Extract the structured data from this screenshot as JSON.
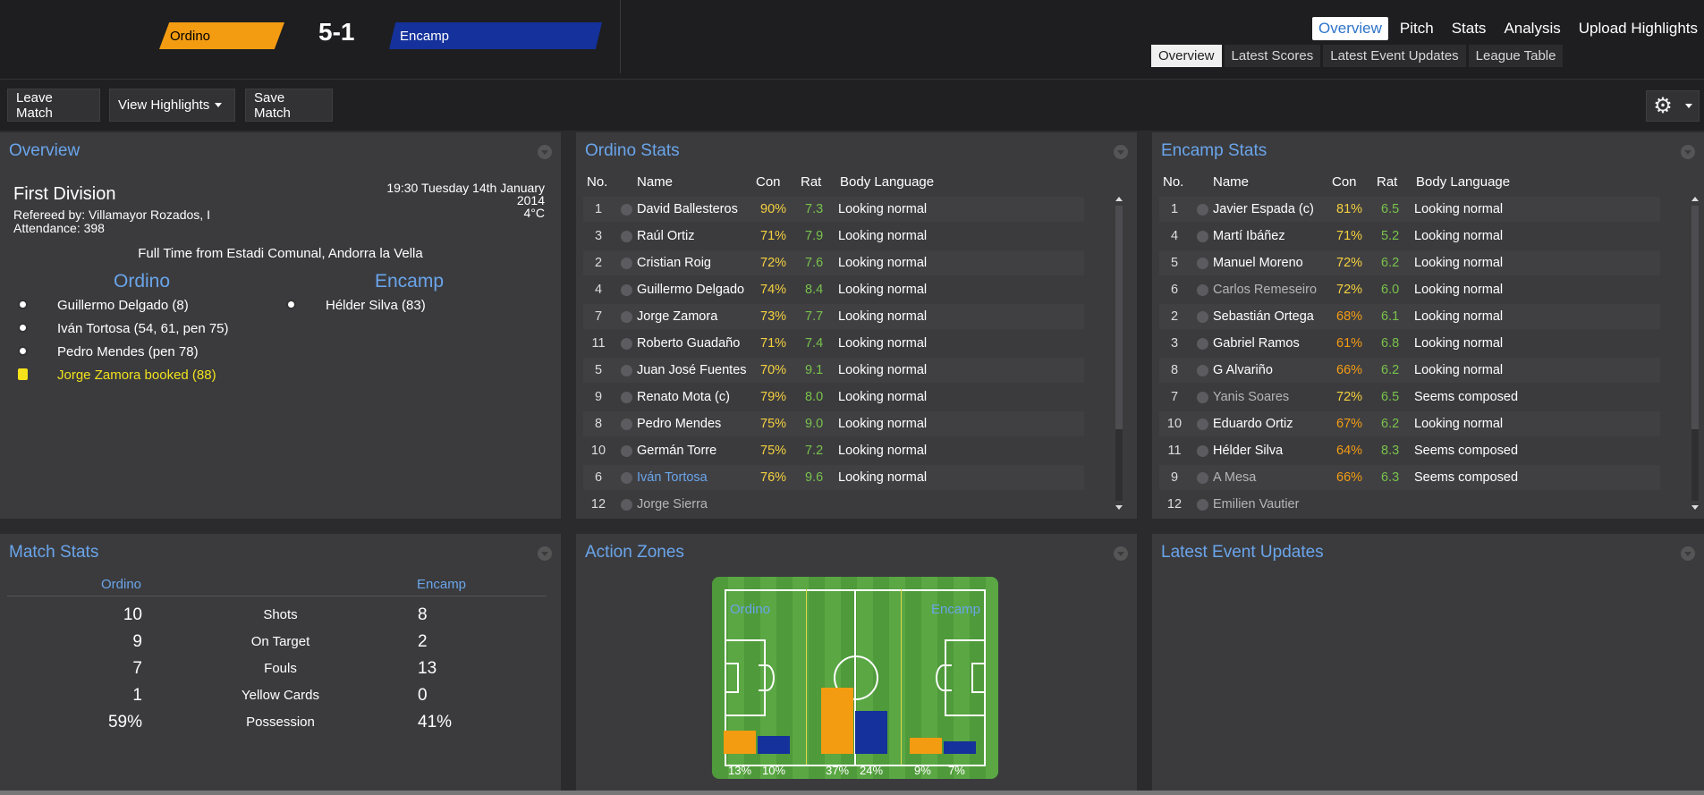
{
  "header": {
    "home_team": "Ordino",
    "away_team": "Encamp",
    "score": "5-1",
    "main_nav": [
      "Overview",
      "Pitch",
      "Stats",
      "Analysis",
      "Upload Highlights"
    ],
    "sub_nav": [
      "Overview",
      "Latest Scores",
      "Latest Event Updates",
      "League Table"
    ]
  },
  "toolbar": {
    "leave_label": "Leave Match",
    "highlights_label": "View Highlights",
    "save_label": "Save Match"
  },
  "overview": {
    "title": "Overview",
    "competition": "First Division",
    "referee": "Refereed by: Villamayor Rozados, I",
    "attendance": "Attendance: 398",
    "time": "19:30 Tuesday 14th January",
    "year": "2014",
    "temperature": "4°C",
    "status": "Full Time from Estadi Comunal, Andorra la Vella",
    "home_name": "Ordino",
    "away_name": "Encamp",
    "home_events": [
      {
        "text": "Guillermo Delgado (8)",
        "type": "goal"
      },
      {
        "text": "Iván Tortosa (54, 61, pen 75)",
        "type": "goal"
      },
      {
        "text": "Pedro Mendes (pen 78)",
        "type": "goal"
      },
      {
        "text": "Jorge Zamora booked (88)",
        "type": "yellow"
      }
    ],
    "away_events": [
      {
        "text": "Hélder Silva (83)",
        "type": "goal"
      }
    ]
  },
  "columns": {
    "no": "No.",
    "name": "Name",
    "con": "Con",
    "rat": "Rat",
    "body": "Body Language"
  },
  "home_stats": {
    "title": "Ordino Stats",
    "rows": [
      {
        "no": "1",
        "name": "David Ballesteros",
        "con": "90%",
        "rat": "7.3",
        "body": "Looking normal"
      },
      {
        "no": "3",
        "name": "Raúl Ortiz",
        "con": "71%",
        "rat": "7.9",
        "body": "Looking normal"
      },
      {
        "no": "2",
        "name": "Cristian Roig",
        "con": "72%",
        "rat": "7.6",
        "body": "Looking normal"
      },
      {
        "no": "4",
        "name": "Guillermo Delgado",
        "con": "74%",
        "rat": "8.4",
        "body": "Looking normal"
      },
      {
        "no": "7",
        "name": "Jorge Zamora",
        "con": "73%",
        "rat": "7.7",
        "body": "Looking normal"
      },
      {
        "no": "11",
        "name": "Roberto Guadaño",
        "con": "71%",
        "rat": "7.4",
        "body": "Looking normal"
      },
      {
        "no": "5",
        "name": "Juan José Fuentes",
        "con": "70%",
        "rat": "9.1",
        "body": "Looking normal"
      },
      {
        "no": "9",
        "name": "Renato Mota (c)",
        "con": "79%",
        "rat": "8.0",
        "body": "Looking normal"
      },
      {
        "no": "8",
        "name": "Pedro Mendes",
        "con": "75%",
        "rat": "9.0",
        "body": "Looking normal"
      },
      {
        "no": "10",
        "name": "Germán Torre",
        "con": "75%",
        "rat": "7.2",
        "body": "Looking normal"
      },
      {
        "no": "6",
        "name": "Iván Tortosa",
        "con": "76%",
        "rat": "9.6",
        "body": "Looking normal"
      },
      {
        "no": "12",
        "name": "Jorge Sierra",
        "con": "",
        "rat": "",
        "body": ""
      }
    ]
  },
  "away_stats": {
    "title": "Encamp Stats",
    "rows": [
      {
        "no": "1",
        "name": "Javier Espada (c)",
        "con": "81%",
        "rat": "6.5",
        "body": "Looking normal"
      },
      {
        "no": "4",
        "name": "Martí Ibáñez",
        "con": "71%",
        "rat": "5.2",
        "body": "Looking normal"
      },
      {
        "no": "5",
        "name": "Manuel Moreno",
        "con": "72%",
        "rat": "6.2",
        "body": "Looking normal"
      },
      {
        "no": "6",
        "name": "Carlos Remeseiro",
        "con": "72%",
        "rat": "6.0",
        "body": "Looking normal"
      },
      {
        "no": "2",
        "name": "Sebastián Ortega",
        "con": "68%",
        "rat": "6.1",
        "body": "Looking normal"
      },
      {
        "no": "3",
        "name": "Gabriel Ramos",
        "con": "61%",
        "rat": "6.8",
        "body": "Looking normal"
      },
      {
        "no": "8",
        "name": "G Alvariño",
        "con": "66%",
        "rat": "6.2",
        "body": "Looking normal"
      },
      {
        "no": "7",
        "name": "Yanis Soares",
        "con": "72%",
        "rat": "6.5",
        "body": "Seems composed"
      },
      {
        "no": "10",
        "name": "Eduardo Ortiz",
        "con": "67%",
        "rat": "6.2",
        "body": "Looking normal"
      },
      {
        "no": "11",
        "name": "Hélder Silva",
        "con": "64%",
        "rat": "8.3",
        "body": "Seems composed"
      },
      {
        "no": "9",
        "name": "A Mesa",
        "con": "66%",
        "rat": "6.3",
        "body": "Seems composed"
      },
      {
        "no": "12",
        "name": "Emilien Vautier",
        "con": "",
        "rat": "",
        "body": ""
      }
    ]
  },
  "match_stats": {
    "title": "Match Stats",
    "home_label": "Ordino",
    "away_label": "Encamp",
    "rows": [
      {
        "home": "10",
        "label": "Shots",
        "away": "8"
      },
      {
        "home": "9",
        "label": "On Target",
        "away": "2"
      },
      {
        "home": "7",
        "label": "Fouls",
        "away": "13"
      },
      {
        "home": "1",
        "label": "Yellow Cards",
        "away": "0"
      },
      {
        "home": "59%",
        "label": "Possession",
        "away": "41%"
      }
    ]
  },
  "action_zones": {
    "title": "Action Zones",
    "home_label": "Ordino",
    "away_label": "Encamp",
    "zones": [
      {
        "home": 13,
        "away": 10,
        "home_label": "13%",
        "away_label": "10%"
      },
      {
        "home": 37,
        "away": 24,
        "home_label": "37%",
        "away_label": "24%"
      },
      {
        "home": 9,
        "away": 7,
        "home_label": "9%",
        "away_label": "7%"
      }
    ],
    "colors": {
      "home": "#f39c12",
      "away": "#15319b"
    }
  },
  "events_panel": {
    "title": "Latest Event Updates"
  }
}
